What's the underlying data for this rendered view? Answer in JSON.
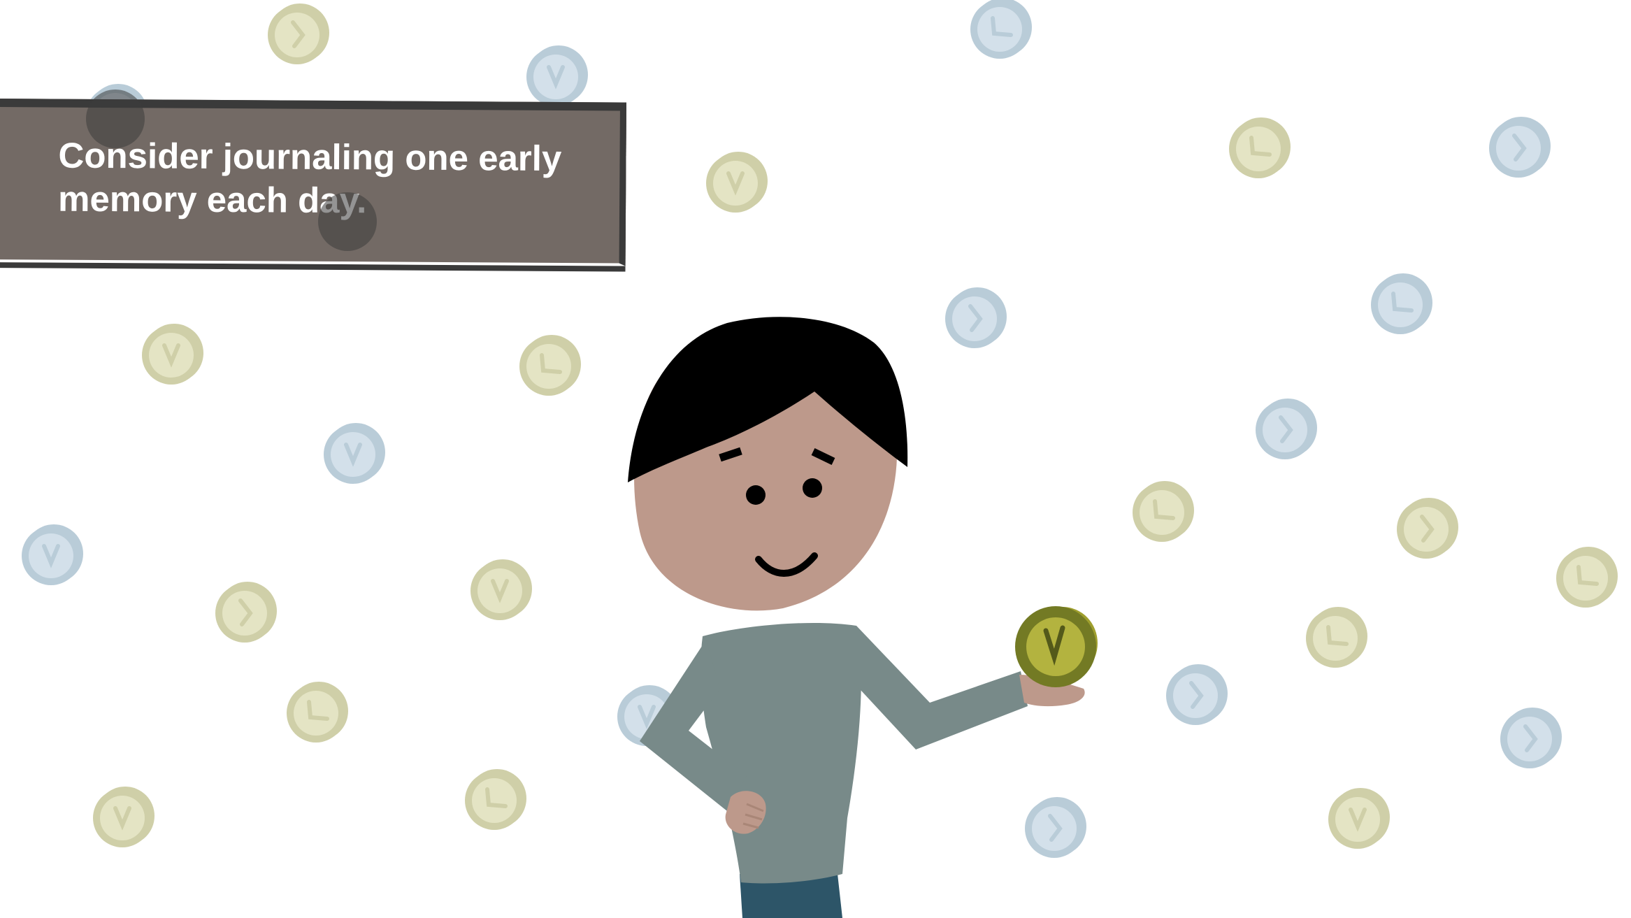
{
  "banner": {
    "message": "Consider journaling one early memory each day."
  },
  "colors": {
    "background": "#ffffff",
    "banner_fill": "#736a65",
    "banner_border": "#3a3a3a",
    "banner_text": "#ffffff",
    "coin_yellow_face": "#e4e4c4",
    "coin_yellow_rim": "#cfcfa8",
    "coin_blue_face": "#d3e0ea",
    "coin_blue_rim": "#b9ccd8",
    "held_coin_face": "#b3b33f",
    "held_coin_rim": "#737a24",
    "skin": "#bd998b",
    "hair": "#000000",
    "shirt": "#788a89",
    "pants": "#2d5568"
  },
  "icons": {
    "background_coin": "clock-coin-icon",
    "held_coin": "clock-coin-icon"
  }
}
